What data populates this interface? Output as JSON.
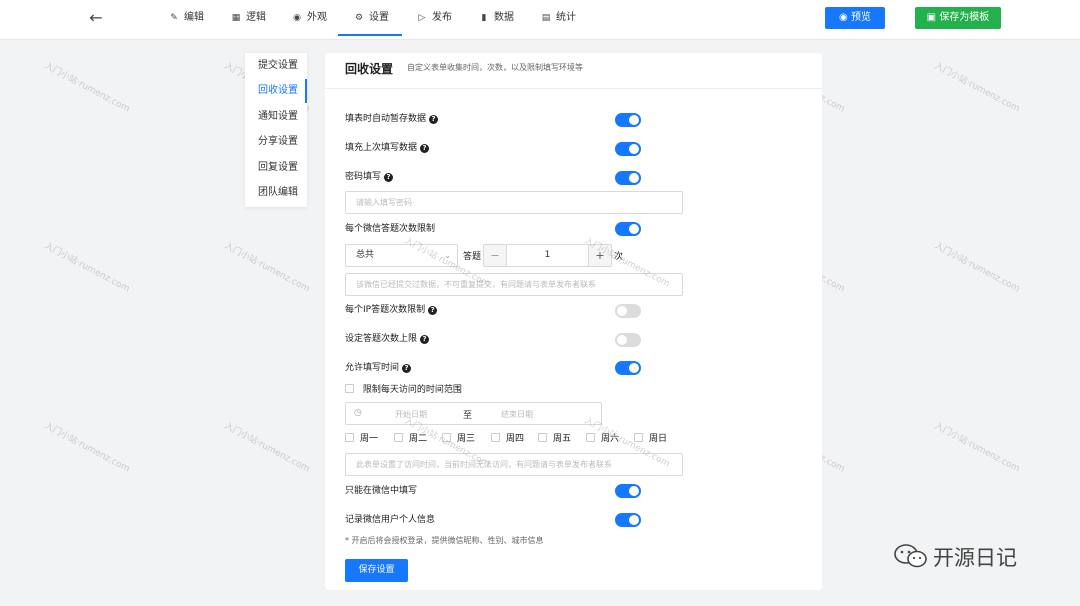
{
  "nav": {
    "back_icon": "arrow-left-icon",
    "tabs": [
      {
        "label": "编辑",
        "icon": "edit-icon",
        "glyph": "✎"
      },
      {
        "label": "逻辑",
        "icon": "grid-icon",
        "glyph": "▦"
      },
      {
        "label": "外观",
        "icon": "eye-icon",
        "glyph": "◉"
      },
      {
        "label": "设置",
        "icon": "gear-icon",
        "glyph": "⚙"
      },
      {
        "label": "发布",
        "icon": "play-circle-icon",
        "glyph": "▷"
      },
      {
        "label": "数据",
        "icon": "bar-chart-icon",
        "glyph": "▮"
      },
      {
        "label": "统计",
        "icon": "stats-icon",
        "glyph": "▤"
      }
    ],
    "active_tab": "设置",
    "preview_label": "预览",
    "save_template_label": "保存为模板"
  },
  "sidemenu": {
    "items": [
      {
        "label": "提交设置"
      },
      {
        "label": "回收设置"
      },
      {
        "label": "通知设置"
      },
      {
        "label": "分享设置"
      },
      {
        "label": "回复设置"
      },
      {
        "label": "团队编辑"
      }
    ],
    "active": "回收设置"
  },
  "main": {
    "title": "回收设置",
    "subtitle": "自定义表单收集时间，次数，以及限制填写环境等",
    "rows": {
      "autosave": {
        "label": "填表时自动暂存数据",
        "help": true,
        "on": true
      },
      "autofill": {
        "label": "填充上次填写数据",
        "help": true,
        "on": true
      },
      "password": {
        "label": "密码填写",
        "help": true,
        "on": true
      },
      "password_placeholder": "请输入填写密码",
      "wechat_limit": {
        "label": "每个微信答题次数限制",
        "on": true
      },
      "wechat_select": "总共",
      "wechat_answer_label": "答题",
      "wechat_count": "1",
      "wechat_unit": "次",
      "wechat_msg_placeholder": "该微信已经提交过数据，不可重复提交，有问题请与表单发布者联系",
      "ip_limit": {
        "label": "每个IP答题次数限制",
        "help": true,
        "on": false
      },
      "max_limit": {
        "label": "设定答题次数上限",
        "help": true,
        "on": false
      },
      "time_allow": {
        "label": "允许填写时间",
        "help": true,
        "on": true
      },
      "daily_range_label": "限制每天访问的时间范围",
      "date_start_placeholder": "开始日期",
      "date_to": "至",
      "date_end_placeholder": "结束日期",
      "weekdays": [
        "周一",
        "周二",
        "周三",
        "周四",
        "周五",
        "周六",
        "周日"
      ],
      "time_msg_placeholder": "此表单设置了访问时间，当前时间无法访问，有问题请与表单发布者联系",
      "wechat_only": {
        "label": "只能在微信中填写",
        "on": true
      },
      "wechat_userinfo": {
        "label": "记录微信用户个人信息",
        "on": true
      },
      "hint": "* 开启后将会授权登录，提供微信昵称、性别、城市信息"
    },
    "save_label": "保存设置"
  },
  "watermark_text": "入门小站·rumenz.com",
  "brand": "开源日记",
  "colors": {
    "primary": "#1677ff",
    "success": "#22b14c",
    "switch_off": "#dcdcdc"
  }
}
